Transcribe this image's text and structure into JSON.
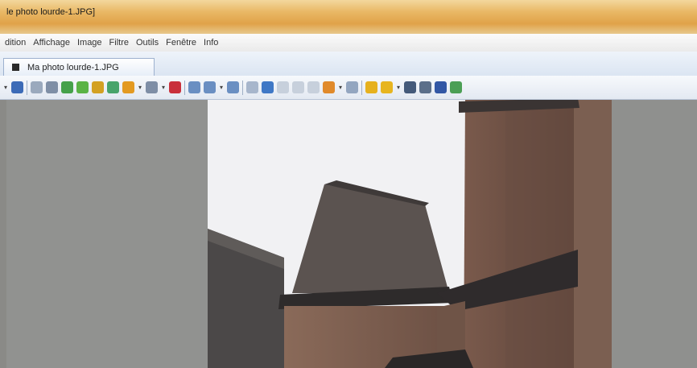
{
  "window": {
    "title": "le photo lourde-1.JPG]"
  },
  "menubar": [
    "dition",
    "Affichage",
    "Image",
    "Filtre",
    "Outils",
    "Fenêtre",
    "Info"
  ],
  "tabs": [
    {
      "label": "Ma photo lourde-1.JPG"
    }
  ],
  "toolbar": {
    "buttons": [
      {
        "name": "menu-dropdown-icon",
        "color": "#555555"
      },
      {
        "name": "save-icon",
        "color": "#3c6bb7"
      },
      {
        "name": "separator"
      },
      {
        "name": "scan-icon",
        "color": "#9aa9bd"
      },
      {
        "name": "film-icon",
        "color": "#7f8fa6"
      },
      {
        "name": "rotate-left-icon",
        "color": "#45a14a"
      },
      {
        "name": "rotate-right-icon",
        "color": "#5ab345"
      },
      {
        "name": "crop-icon",
        "color": "#d3a123"
      },
      {
        "name": "resize-icon",
        "color": "#48a46b"
      },
      {
        "name": "effects-icon",
        "color": "#e39a21"
      },
      {
        "name": "dropdown-icon"
      },
      {
        "name": "adjust-icon",
        "color": "#7e8ea6"
      },
      {
        "name": "dropdown-icon"
      },
      {
        "name": "redeye-icon",
        "color": "#c9303b"
      },
      {
        "name": "separator"
      },
      {
        "name": "zoom-in-icon",
        "color": "#6a8fc2"
      },
      {
        "name": "zoom-fit-icon",
        "color": "#6a8fc2"
      },
      {
        "name": "dropdown-icon"
      },
      {
        "name": "zoom-out-icon",
        "color": "#6a8fc2"
      },
      {
        "name": "separator"
      },
      {
        "name": "previous-icon",
        "color": "#a7b6cc"
      },
      {
        "name": "next-icon",
        "color": "#3f78c6"
      },
      {
        "name": "first-page-icon",
        "color": "#c7d0dc"
      },
      {
        "name": "page-icon",
        "color": "#c7d0dc"
      },
      {
        "name": "last-page-icon",
        "color": "#c7d0dc"
      },
      {
        "name": "slideshow-icon",
        "color": "#e08a2b"
      },
      {
        "name": "dropdown-icon"
      },
      {
        "name": "capture-icon",
        "color": "#93a6c0"
      },
      {
        "name": "separator"
      },
      {
        "name": "fullscreen-icon",
        "color": "#e6b11e"
      },
      {
        "name": "thumbnail-icon",
        "color": "#e7b51f"
      },
      {
        "name": "dropdown-icon"
      },
      {
        "name": "find-icon",
        "color": "#445a7a"
      },
      {
        "name": "print-icon",
        "color": "#5b6f8a"
      },
      {
        "name": "disk-icon",
        "color": "#3257a5"
      },
      {
        "name": "properties-icon",
        "color": "#4b9f55"
      }
    ]
  },
  "colors": {
    "titlebar": "#e7b563",
    "viewer_bg": "#8f908e",
    "sky": "#f2f1f3"
  }
}
